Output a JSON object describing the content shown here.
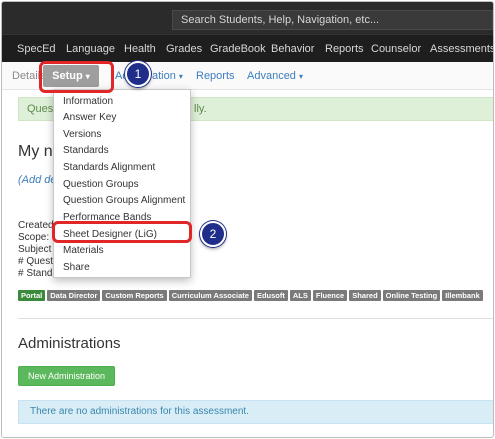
{
  "search": {
    "placeholder": "Search Students, Help, Navigation, etc..."
  },
  "main_nav": {
    "items": [
      "SpecEd",
      "Language",
      "Health",
      "Grades",
      "GradeBook",
      "Behavior",
      "Reports",
      "Counselor",
      "Assessments"
    ]
  },
  "sub_nav": {
    "details": "Details",
    "setup": "Setup",
    "administration_fragment": "Ad",
    "administration_tail": "ation",
    "reports": "Reports",
    "advanced": "Advanced"
  },
  "alert": {
    "left": "Quest",
    "right": "lly."
  },
  "assessment": {
    "title_fragment": "My ne",
    "add_description_fragment": "(Add de",
    "meta_lines": [
      "Created",
      "Scope:",
      "Subject",
      "# Questi",
      "# Standa"
    ]
  },
  "setup_menu": {
    "items": [
      "Information",
      "Answer Key",
      "Versions",
      "Standards",
      "Standards Alignment",
      "Question Groups",
      "Question Groups Alignment",
      "Performance Bands",
      "Sheet Designer (LiG)",
      "Materials",
      "Share"
    ]
  },
  "tags": [
    "Portal",
    "Data Director",
    "Custom Reports",
    "Curriculum Associate",
    "Edusoft",
    "ALS",
    "Fluence",
    "Shared",
    "Online Testing",
    "Illembank"
  ],
  "administrations": {
    "heading": "Administrations",
    "new_button": "New Administration",
    "empty_message": "There are no administrations for this assessment."
  },
  "callouts": [
    "1",
    "2"
  ],
  "colors": {
    "highlight": "#e02626",
    "badge": "#1f2e8a",
    "success_button": "#5cb85c",
    "link": "#3d7ebc"
  }
}
